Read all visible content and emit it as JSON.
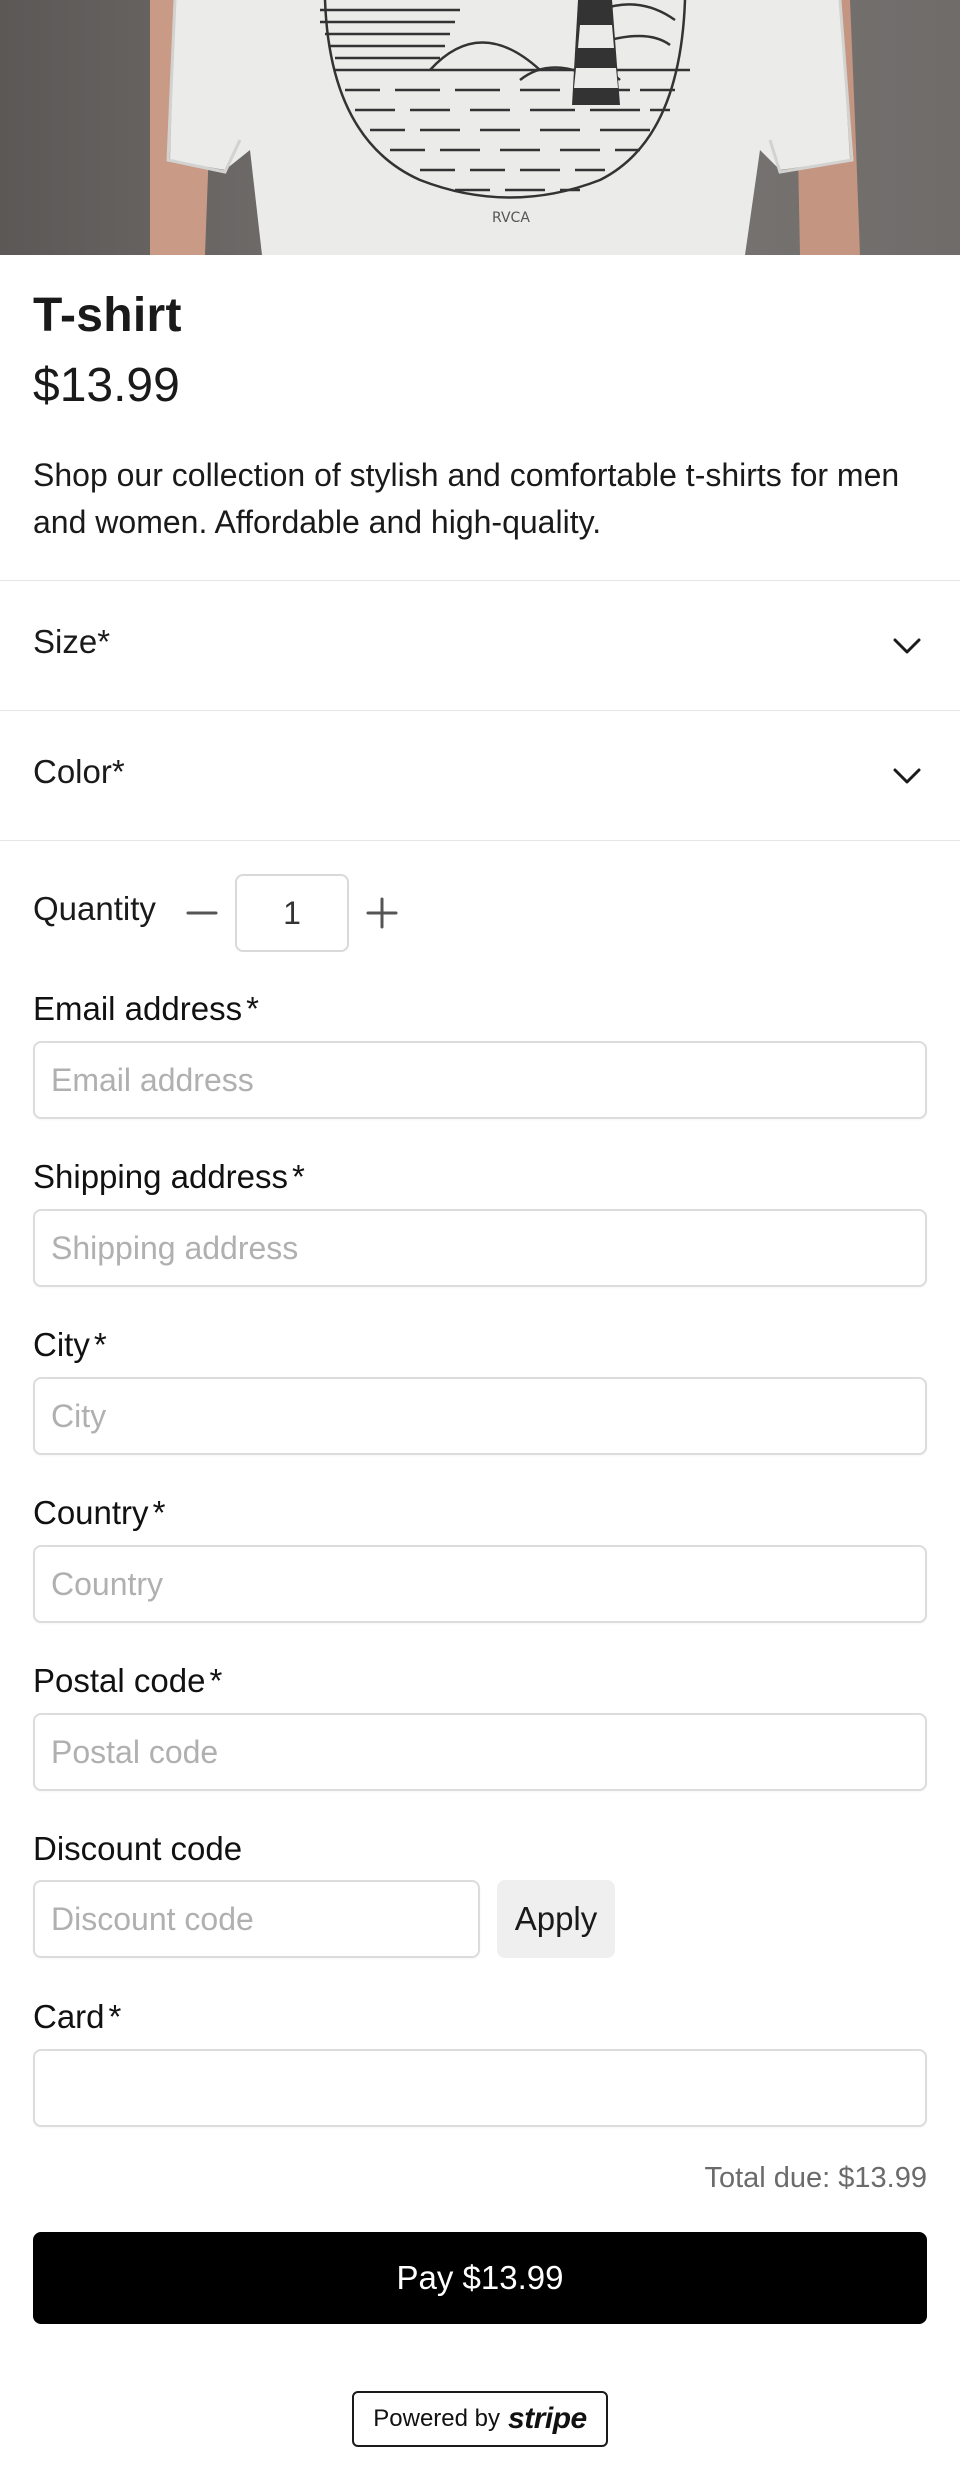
{
  "product": {
    "name": "T-shirt",
    "price": "$13.99",
    "description": "Shop our collection of stylish and comfortable t-shirts for men and women. Affordable and high-quality.",
    "image_icon": "product-photo",
    "image_brand_text": "RVCA"
  },
  "options": {
    "size_label": "Size",
    "color_label": "Color",
    "required_mark": "*",
    "chevron_icon": "chevron-down-icon"
  },
  "quantity": {
    "label": "Quantity",
    "value": "1",
    "decrement_icon": "minus-icon",
    "increment_icon": "plus-icon"
  },
  "form": {
    "email": {
      "label": "Email address",
      "placeholder": "Email address",
      "value": ""
    },
    "shipping": {
      "label": "Shipping address",
      "placeholder": "Shipping address",
      "value": ""
    },
    "city": {
      "label": "City",
      "placeholder": "City",
      "value": ""
    },
    "country": {
      "label": "Country",
      "placeholder": "Country",
      "value": ""
    },
    "postal": {
      "label": "Postal code",
      "placeholder": "Postal code",
      "value": ""
    },
    "discount": {
      "label": "Discount code",
      "placeholder": "Discount code",
      "value": "",
      "apply_label": "Apply"
    },
    "card": {
      "label": "Card",
      "value": ""
    }
  },
  "checkout": {
    "total_text": "Total due: $13.99",
    "pay_label": "Pay $13.99"
  },
  "footer": {
    "powered_by": "Powered by",
    "brand": "stripe"
  },
  "colors": {
    "pay_button": "#000000",
    "apply_button": "#efefef",
    "divider": "#e6e6e6"
  }
}
